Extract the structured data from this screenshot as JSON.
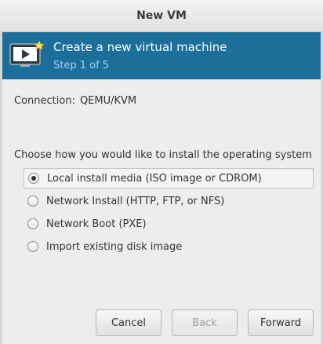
{
  "window": {
    "title": "New VM"
  },
  "header": {
    "title": "Create a new virtual machine",
    "step": "Step 1 of 5",
    "icon": "monitor-play-icon"
  },
  "connection": {
    "label": "Connection:",
    "value": "QEMU/KVM"
  },
  "install": {
    "prompt": "Choose how you would like to install the operating system",
    "options": [
      {
        "label": "Local install media (ISO image or CDROM)",
        "selected": true
      },
      {
        "label": "Network Install (HTTP, FTP, or NFS)",
        "selected": false
      },
      {
        "label": "Network Boot (PXE)",
        "selected": false
      },
      {
        "label": "Import existing disk image",
        "selected": false
      }
    ]
  },
  "buttons": {
    "cancel": "Cancel",
    "back": "Back",
    "forward": "Forward"
  },
  "colors": {
    "header_bg": "#1c6f9b",
    "header_title": "#ffffff",
    "header_step": "#9fd0ee"
  }
}
